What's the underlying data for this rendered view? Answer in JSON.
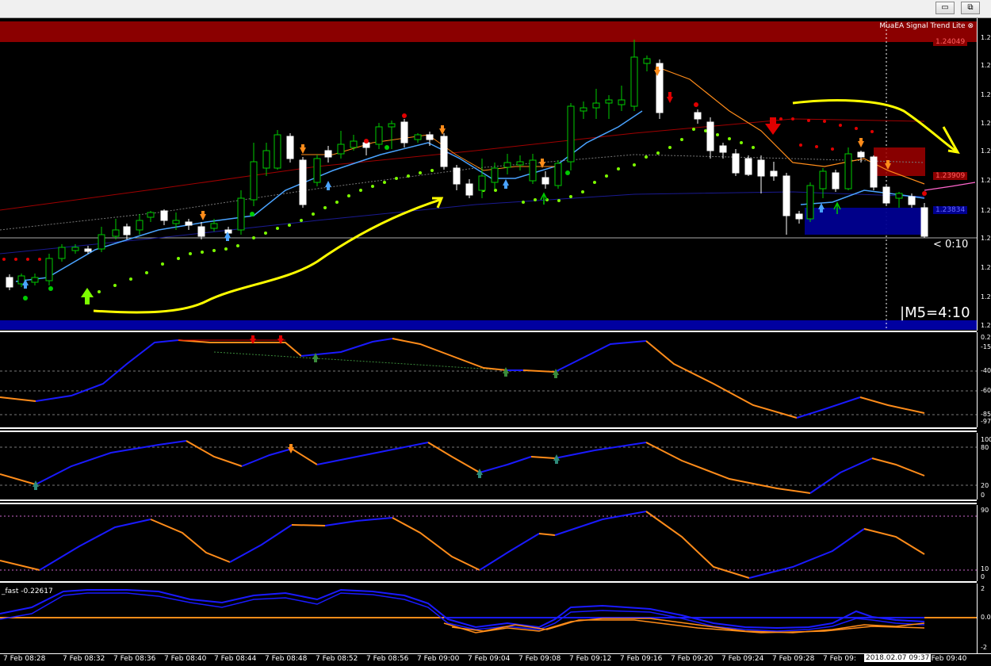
{
  "window": {
    "minimize_label": "▭",
    "restore_label": "⧉"
  },
  "main_chart": {
    "signal_label": "MuaEA Signal Trend Lite ⊗",
    "timer_small": "< 0:10",
    "timer_big": "|M5=4:10",
    "price_box_red_1": "1.24049",
    "price_box_red_2": "1.23909",
    "price_box_blue": "1.23834",
    "price_axis_labels": [
      "1.2",
      "1.2",
      "1.2",
      "1.2",
      "1.2",
      "1.2",
      "1.2",
      "1.2",
      "1.2",
      "1.2",
      "1.2"
    ]
  },
  "sub1": {
    "axis_labels": [
      "0.2",
      "-15",
      "-40",
      "-60",
      "-85",
      "-97"
    ]
  },
  "sub2": {
    "axis_labels": [
      "100",
      "80",
      "20",
      "0"
    ]
  },
  "sub3": {
    "axis_labels": [
      "90",
      "10",
      "0"
    ]
  },
  "sub4": {
    "label": "_fast -0.22617",
    "axis_labels": [
      "2",
      "0.0",
      "-2"
    ]
  },
  "time_axis": {
    "labels": [
      "7 Feb 08:28",
      "7 Feb 08:32",
      "7 Feb 08:36",
      "7 Feb 08:40",
      "7 Feb 08:44",
      "7 Feb 08:48",
      "7 Feb 08:52",
      "7 Feb 08:56",
      "7 Feb 09:00",
      "7 Feb 09:04",
      "7 Feb 09:08",
      "7 Feb 09:12",
      "7 Feb 09:16",
      "7 Feb 09:20",
      "7 Feb 09:24",
      "7 Feb 09:28",
      "7 Feb 09:",
      "7 Feb 09:40"
    ],
    "date_tag": "2018.02.07 09:37"
  },
  "colors": {
    "bull": "#00cc00",
    "bear": "#ffffff",
    "ribbon_red": "#8b0000",
    "ribbon_blue": "#00008b",
    "line_blue": "#1a1aff",
    "line_orange": "#ff8c1a",
    "yellow": "#ffff00",
    "lime": "#7cfc00"
  }
}
